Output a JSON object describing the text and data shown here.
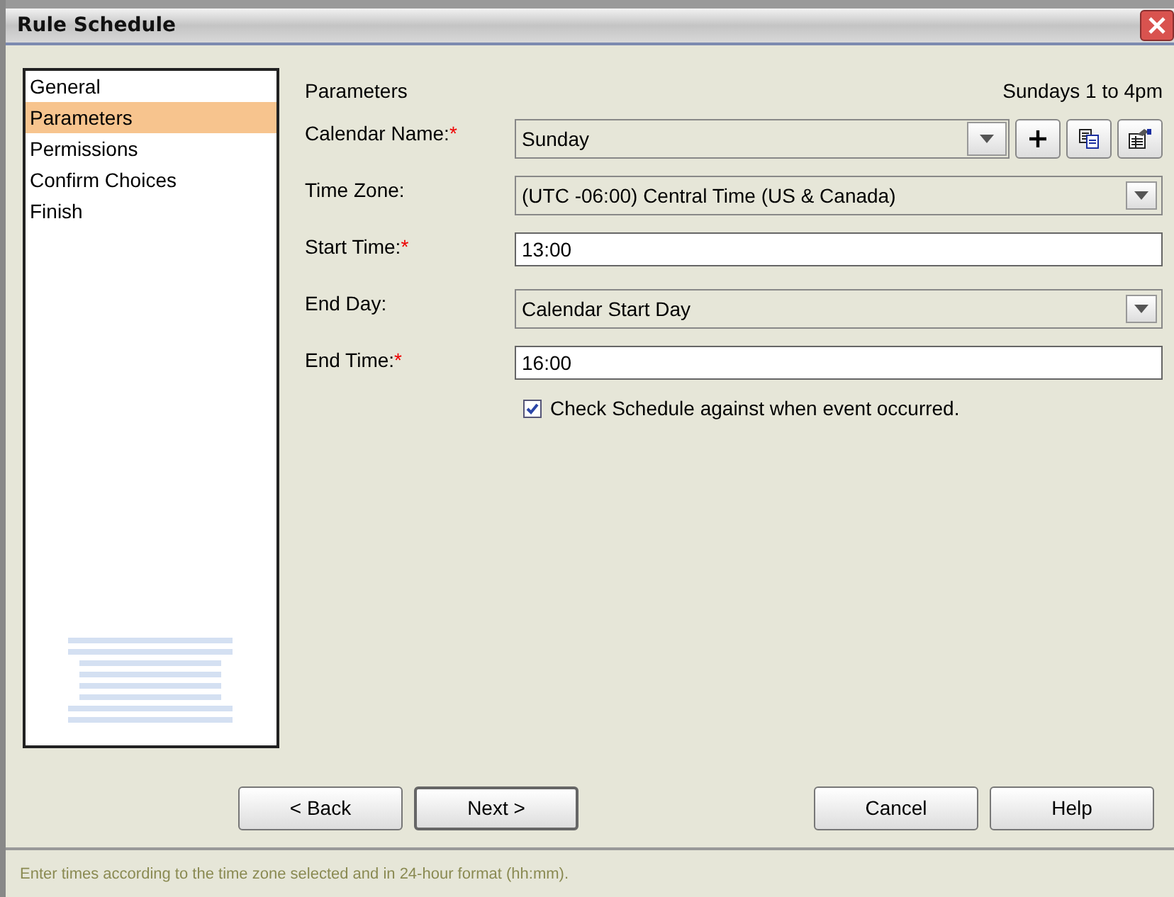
{
  "window": {
    "title": "Rule Schedule"
  },
  "sidebar": {
    "items": [
      {
        "label": "General",
        "selected": false
      },
      {
        "label": "Parameters",
        "selected": true
      },
      {
        "label": "Permissions",
        "selected": false
      },
      {
        "label": "Confirm Choices",
        "selected": false
      },
      {
        "label": "Finish",
        "selected": false
      }
    ]
  },
  "panel": {
    "title": "Parameters",
    "summary": "Sundays 1 to 4pm"
  },
  "fields": [
    {
      "kind": "combo-tools",
      "label": "Calendar Name:",
      "required_mark": "*",
      "value": "Sunday"
    },
    {
      "kind": "combo",
      "label": "Time Zone:",
      "value": "(UTC -06:00) Central Time (US & Canada)"
    },
    {
      "kind": "text",
      "label": "Start Time:",
      "required_mark": "*",
      "value": "13:00"
    },
    {
      "kind": "combo",
      "label": "End Day:",
      "value": "Calendar Start Day"
    },
    {
      "kind": "text",
      "label": "End Time:",
      "required_mark": "*",
      "value": "16:00"
    }
  ],
  "checkbox": {
    "label": "Check Schedule against when event occurred.",
    "checked": true
  },
  "buttons": [
    "< Back",
    "Next >",
    "Cancel",
    "Help"
  ],
  "status_bar": "Enter times according to the time zone selected and in 24-hour format (hh:mm)."
}
